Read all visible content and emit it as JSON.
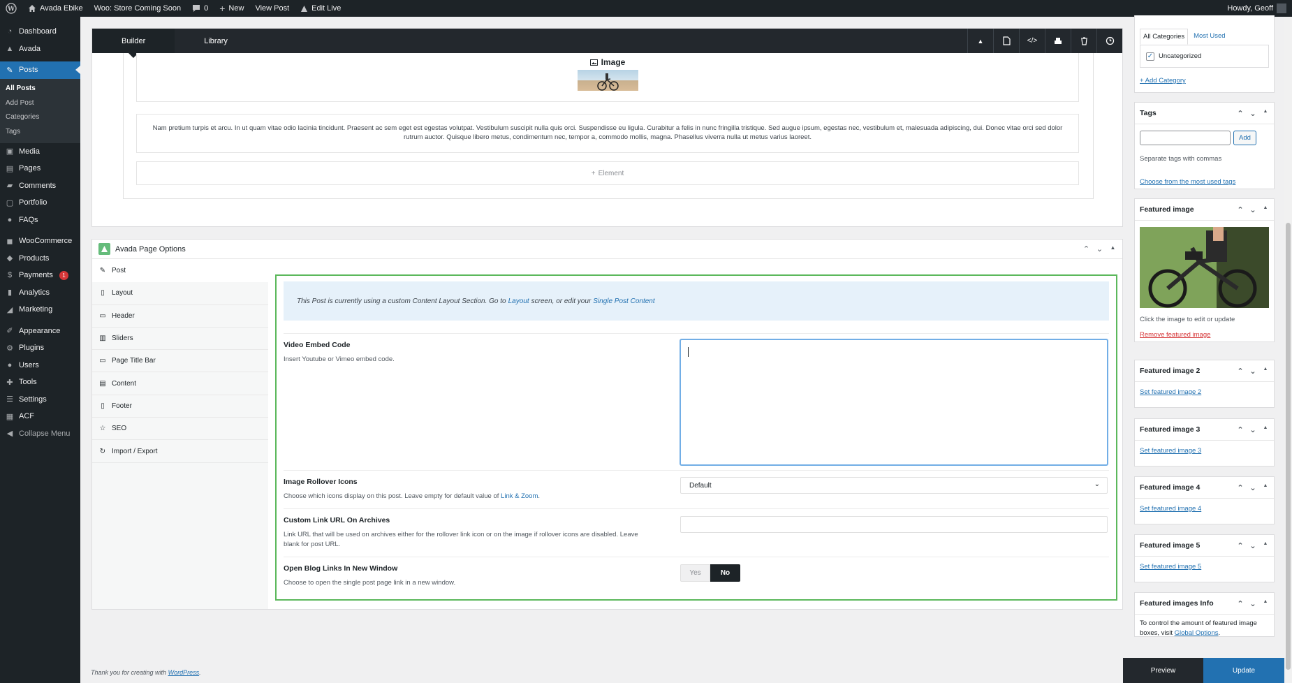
{
  "adminbar": {
    "site_name": "Avada Ebike",
    "store_notice": "Woo: Store Coming Soon",
    "comments_count": "0",
    "new_label": "New",
    "view_post": "View Post",
    "edit_live": "Edit Live",
    "howdy": "Howdy, Geoff"
  },
  "sidebar": {
    "items": {
      "dashboard": "Dashboard",
      "avada": "Avada",
      "posts": "Posts",
      "media": "Media",
      "pages": "Pages",
      "comments": "Comments",
      "portfolio": "Portfolio",
      "faqs": "FAQs",
      "woocommerce": "WooCommerce",
      "products": "Products",
      "payments": "Payments",
      "analytics": "Analytics",
      "marketing": "Marketing",
      "appearance": "Appearance",
      "plugins": "Plugins",
      "users": "Users",
      "tools": "Tools",
      "settings": "Settings",
      "acf": "ACF",
      "collapse": "Collapse Menu"
    },
    "payments_badge": "1",
    "posts_submenu": {
      "all_posts": "All Posts",
      "add_post": "Add Post",
      "categories": "Categories",
      "tags": "Tags"
    }
  },
  "builder": {
    "tabs": {
      "builder": "Builder",
      "library": "Library"
    },
    "image_element_title": "Image",
    "text_element": "Nam pretium turpis et arcu. In ut quam vitae odio lacinia tincidunt. Praesent ac sem eget est egestas volutpat. Vestibulum suscipit nulla quis orci. Suspendisse eu ligula. Curabitur a felis in nunc fringilla tristique. Sed augue ipsum, egestas nec, vestibulum et, malesuada adipiscing, dui. Donec vitae orci sed dolor rutrum auctor. Quisque libero metus, condimentum nec, tempor a, commodo mollis, magna. Phasellus viverra nulla ut metus varius laoreet.",
    "add_element": "Element"
  },
  "options": {
    "title": "Avada Page Options",
    "tabs": {
      "post": "Post",
      "layout": "Layout",
      "header": "Header",
      "sliders": "Sliders",
      "page_title_bar": "Page Title Bar",
      "content": "Content",
      "footer": "Footer",
      "seo": "SEO",
      "import_export": "Import / Export"
    },
    "notice": {
      "before": "This Post is currently using a custom Content Layout Section. Go to",
      "layout_link": "Layout",
      "middle": "screen, or edit your",
      "content_link": "Single Post Content"
    },
    "video": {
      "label": "Video Embed Code",
      "desc": "Insert Youtube or Vimeo embed code.",
      "value": ""
    },
    "rollover": {
      "label": "Image Rollover Icons",
      "desc": "Choose which icons display on this post. Leave empty for default value of",
      "desc_link": "Link & Zoom",
      "desc_end": ".",
      "value": "Default"
    },
    "custom_link": {
      "label": "Custom Link URL On Archives",
      "desc": "Link URL that will be used on archives either for the rollover link icon or on the image if rollover icons are disabled. Leave blank for post URL.",
      "value": ""
    },
    "new_window": {
      "label": "Open Blog Links In New Window",
      "desc": "Choose to open the single post page link in a new window.",
      "yes": "Yes",
      "no": "No"
    }
  },
  "right": {
    "categories": {
      "tab_all": "All Categories",
      "tab_most": "Most Used",
      "item": "Uncategorized",
      "add": "+ Add Category"
    },
    "tags": {
      "title": "Tags",
      "add_btn": "Add",
      "hint": "Separate tags with commas",
      "choose": "Choose from the most used tags"
    },
    "featured": {
      "title": "Featured image",
      "hint": "Click the image to edit or update",
      "remove": "Remove featured image"
    },
    "featured2": {
      "title": "Featured image 2",
      "link": "Set featured image 2"
    },
    "featured3": {
      "title": "Featured image 3",
      "link": "Set featured image 3"
    },
    "featured4": {
      "title": "Featured image 4",
      "link": "Set featured image 4"
    },
    "featured5": {
      "title": "Featured image 5",
      "link": "Set featured image 5"
    },
    "info": {
      "title": "Featured images Info",
      "text": "To control the amount of featured image boxes, visit",
      "link": "Global Options",
      "end": "."
    }
  },
  "footer": {
    "text": "Thank you for creating with",
    "link": "WordPress",
    "end": "."
  },
  "actions": {
    "preview": "Preview",
    "update": "Update"
  }
}
